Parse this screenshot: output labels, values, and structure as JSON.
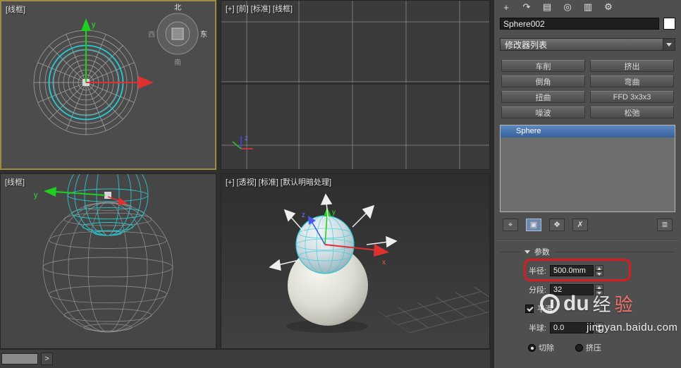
{
  "viewports": {
    "top_left": {
      "label": "[线框]",
      "axis_y": "y",
      "compass": {
        "north": "北",
        "east": "东",
        "south": "南",
        "west": "西"
      }
    },
    "top_right": {
      "label": "[+] [前] [标准] [线框]",
      "axis_z": "z"
    },
    "bottom_left": {
      "label": "[线框]",
      "axis_y": "y"
    },
    "bottom_right": {
      "label": "[+] [透视] [标准] [默认明暗处理]",
      "axis_x": "x",
      "axis_y": "y",
      "axis_z": "z"
    }
  },
  "command_panel": {
    "tabs": [
      {
        "name": "create",
        "glyph": "+"
      },
      {
        "name": "modify",
        "glyph": "↷"
      },
      {
        "name": "hierarchy",
        "glyph": "▤"
      },
      {
        "name": "motion",
        "glyph": "◎"
      },
      {
        "name": "display",
        "glyph": "▥"
      },
      {
        "name": "utilities",
        "glyph": "⚙"
      }
    ],
    "object_name": "Sphere002",
    "modifier_list_label": "修改器列表",
    "modifier_buttons": [
      "车削",
      "挤出",
      "倒角",
      "弯曲",
      "扭曲",
      "FFD 3x3x3",
      "噪波",
      "松弛"
    ],
    "stack_selected_item": "Sphere",
    "stack_tools": [
      {
        "name": "pin-stack",
        "glyph": "⌖"
      },
      {
        "name": "show-end-result",
        "glyph": "▣"
      },
      {
        "name": "make-unique",
        "glyph": "❖"
      },
      {
        "name": "remove-modifier",
        "glyph": "✗"
      },
      {
        "name": "configure-modifier-sets",
        "glyph": "≣"
      }
    ],
    "parameters": {
      "rollout_title": "参数",
      "radius_label": "半径:",
      "radius_value": "500.0mm",
      "segments_label": "分段:",
      "segments_value": "32",
      "smooth_label": "平滑",
      "hemisphere_label": "半球:",
      "hemisphere_value": "0.0",
      "chop_label": "切除",
      "squash_label": "挤压"
    }
  },
  "watermark": {
    "brand_latin": "du",
    "brand_cjk_a": "经",
    "brand_cjk_b": "验",
    "url": "jingyan.baidu.com"
  },
  "status_bar": {
    "listener_value": "",
    "go_label": ">"
  }
}
